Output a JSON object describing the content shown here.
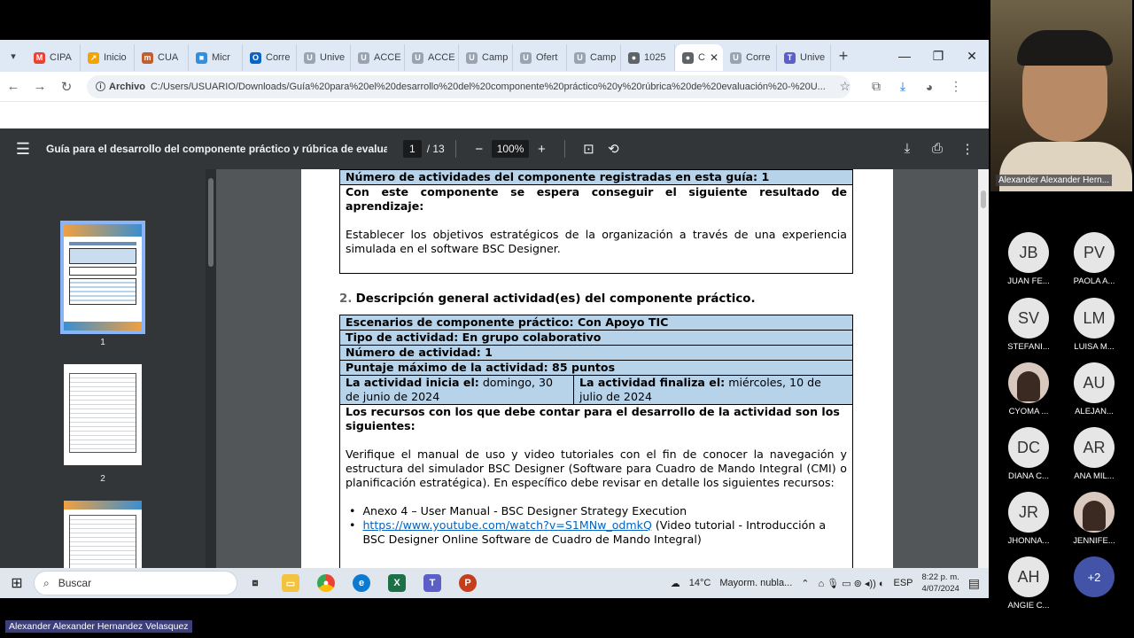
{
  "browser": {
    "tabs": [
      {
        "label": "CIPA",
        "icon": "gmail-icon",
        "color": "#ea4335",
        "glyph": "M"
      },
      {
        "label": "Inicio",
        "icon": "arrow-icon",
        "color": "#f4a300",
        "glyph": "↗"
      },
      {
        "label": "CUA",
        "icon": "puzzle-icon",
        "color": "#c06030",
        "glyph": "m"
      },
      {
        "label": "Micr",
        "icon": "microsoft-icon",
        "color": "#2f8fe0",
        "glyph": "■"
      },
      {
        "label": "Corre",
        "icon": "outlook-icon",
        "color": "#0a64c8",
        "glyph": "O"
      },
      {
        "label": "Unive",
        "icon": "moodle-icon",
        "color": "#9aa4b0",
        "glyph": "U"
      },
      {
        "label": "ACCE",
        "icon": "moodle-icon",
        "color": "#9aa4b0",
        "glyph": "U"
      },
      {
        "label": "ACCE",
        "icon": "moodle-icon",
        "color": "#9aa4b0",
        "glyph": "U"
      },
      {
        "label": "Camp",
        "icon": "moodle-icon",
        "color": "#9aa4b0",
        "glyph": "U"
      },
      {
        "label": "Ofert",
        "icon": "moodle-icon",
        "color": "#9aa4b0",
        "glyph": "U"
      },
      {
        "label": "Camp",
        "icon": "moodle-icon",
        "color": "#9aa4b0",
        "glyph": "U"
      },
      {
        "label": "1025",
        "icon": "globe-icon",
        "color": "#5f6368",
        "glyph": "●"
      }
    ],
    "active_tab": {
      "label": "C",
      "icon": "globe-icon",
      "close": "✕"
    },
    "tabs_after": [
      {
        "label": "Corre",
        "icon": "moodle-icon",
        "color": "#9aa4b0",
        "glyph": "U"
      },
      {
        "label": "Unive",
        "icon": "teams-icon",
        "color": "#5b5fc7",
        "glyph": "T"
      }
    ],
    "new_tab": "+",
    "security_chip": "Archivo",
    "url": "C:/Users/USUARIO/Downloads/Guía%20para%20el%20desarrollo%20del%20componente%20práctico%20y%20rúbrica%20de%20evaluación%20-%20U..."
  },
  "pdf": {
    "title": "Guía para el desarrollo del componente práctico y rúbrica de evaluació...",
    "page_current": "1",
    "page_total": "/ 13",
    "zoom": "100%",
    "thumbnails": [
      "1",
      "2"
    ]
  },
  "document": {
    "top_row_cut": "Número de actividades del componente registradas en esta guía: 1",
    "outcome_heading": "Con este componente se espera conseguir el siguiente resultado de aprendizaje:",
    "outcome_text": "Establecer los objetivos estratégicos de la organización a través de una experiencia simulada en el software BSC Designer.",
    "section_number": "2.",
    "section_title": "Descripción general actividad(es) del componente práctico.",
    "rows": [
      "Escenarios de componente práctico: Con Apoyo TIC",
      "Tipo de actividad: En grupo colaborativo",
      "Número de actividad: 1",
      "Puntaje máximo de la actividad: 85 puntos"
    ],
    "start_label": "La actividad inicia el:",
    "start_value": " domingo, 30 de junio de 2024",
    "end_label": "La actividad finaliza el:",
    "end_value": " miércoles, 10 de julio de 2024",
    "resources_heading": "Los recursos con los que debe contar para el desarrollo de la actividad son los siguientes:",
    "resources_text": "Verifique el manual de uso y video tutoriales con el fin de conocer la navegación y estructura del simulador BSC Designer (Software para Cuadro de Mando Integral (CMI) o planificación estratégica). En específico debe revisar en detalle los siguientes recursos:",
    "bullet1": "Anexo 4 – User Manual - BSC Designer Strategy Execution",
    "bullet2_link": "https://www.youtube.com/watch?v=S1MNw_odmkQ",
    "bullet2_text": " (Video tutorial - Introducción a BSC Designer Online Software de Cuadro de Mando Integral)"
  },
  "taskbar": {
    "search_placeholder": "Buscar",
    "weather_temp": "14°C",
    "weather_text": "Mayorm. nubla...",
    "language": "ESP",
    "time": "8:22 p. m.",
    "date": "4/07/2024"
  },
  "meeting": {
    "presenter_name": "Alexander Alexander Hern...",
    "participants": [
      {
        "initials": "JB",
        "name": "JUAN FE...",
        "color": "#e6e6e6"
      },
      {
        "initials": "PV",
        "name": "PAOLA A...",
        "color": "#e6e6e6"
      },
      {
        "initials": "SV",
        "name": "STEFANI...",
        "color": "#e6e6e6"
      },
      {
        "initials": "LM",
        "name": "LUISA M...",
        "color": "#e6e6e6"
      },
      {
        "initials": "",
        "name": "CYOMA ...",
        "color": "#d9c8bd"
      },
      {
        "initials": "AU",
        "name": "ALEJAN...",
        "color": "#e6e6e6"
      },
      {
        "initials": "DC",
        "name": "DIANA C...",
        "color": "#e6e6e6"
      },
      {
        "initials": "AR",
        "name": "ANA MIL...",
        "color": "#e6e6e6"
      },
      {
        "initials": "JR",
        "name": "JHONNA...",
        "color": "#e6e6e6"
      },
      {
        "initials": "",
        "name": "JENNIFE...",
        "color": "#d9c8bd"
      },
      {
        "initials": "AH",
        "name": "ANGIE C...",
        "color": "#e6e6e6"
      },
      {
        "initials": "+2",
        "name": "",
        "color": "#4353a8"
      }
    ],
    "bottom_name": "Alexander Alexander Hernandez Velasquez"
  }
}
